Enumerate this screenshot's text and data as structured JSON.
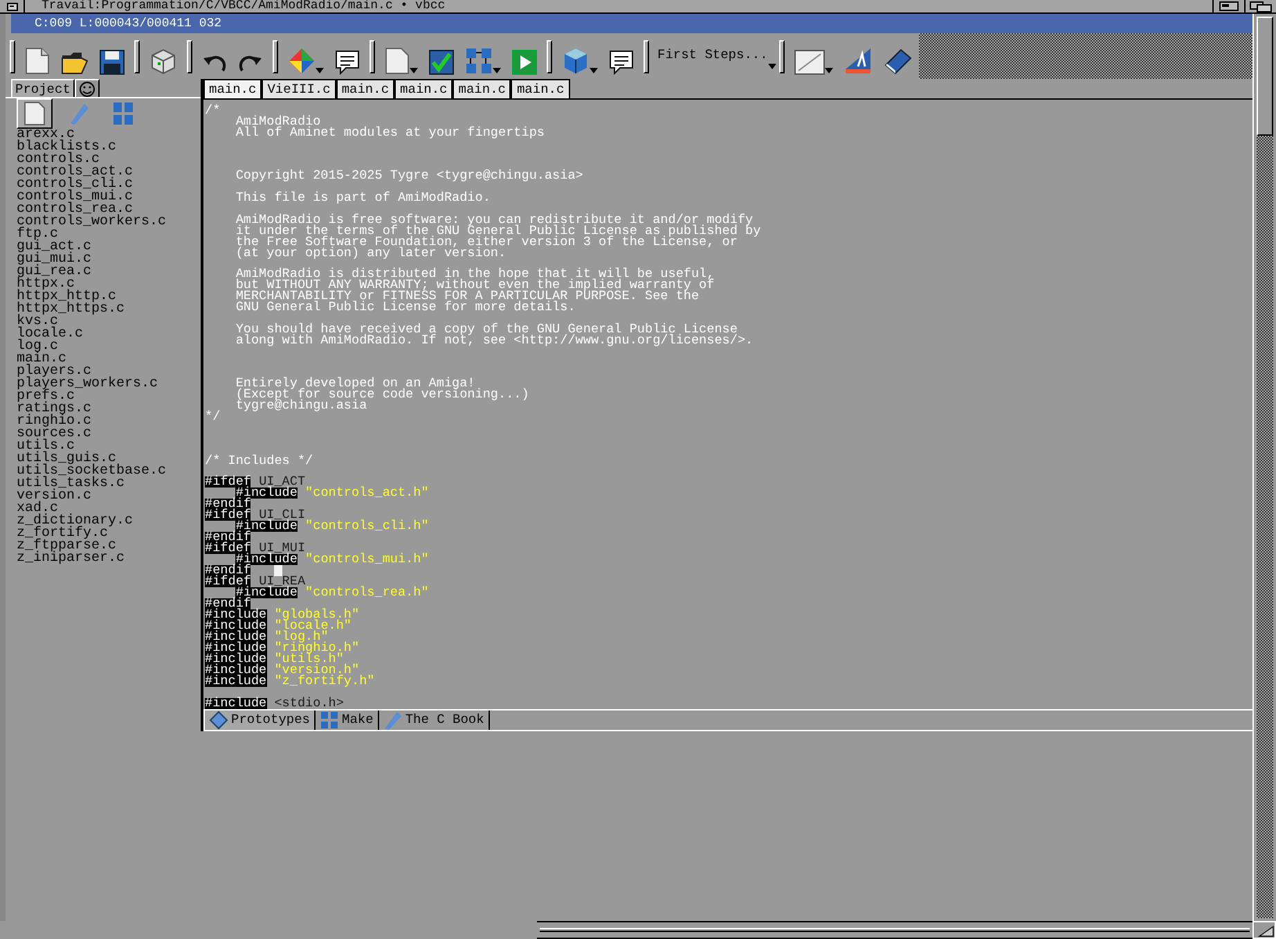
{
  "window": {
    "title": "Travail:Programmation/C/VBCC/AmiModRadio/main.c • vbcc"
  },
  "status_bar": {
    "text": "C:009 L:000043/000411 032"
  },
  "toolbar": {
    "dropdown": {
      "value": "First Steps..."
    }
  },
  "side_panel": {
    "tabs": [
      {
        "kind": "text",
        "label": "Project",
        "selected": true
      },
      {
        "kind": "smiley",
        "selected": false
      }
    ],
    "modes": [
      {
        "kind": "file",
        "selected": true
      },
      {
        "kind": "pen",
        "selected": false
      },
      {
        "kind": "grid",
        "selected": false
      }
    ],
    "files": [
      "arexx.c",
      "blacklists.c",
      "controls.c",
      "controls_act.c",
      "controls_cli.c",
      "controls_mui.c",
      "controls_rea.c",
      "controls_workers.c",
      "ftp.c",
      "gui_act.c",
      "gui_mui.c",
      "gui_rea.c",
      "httpx.c",
      "httpx_http.c",
      "httpx_https.c",
      "kvs.c",
      "locale.c",
      "log.c",
      "main.c",
      "players.c",
      "players_workers.c",
      "prefs.c",
      "ratings.c",
      "ringhio.c",
      "sources.c",
      "utils.c",
      "utils_guis.c",
      "utils_socketbase.c",
      "utils_tasks.c",
      "version.c",
      "xad.c",
      "z_dictionary.c",
      "z_fortify.c",
      "z_ftpparse.c",
      "z_iniparser.c"
    ]
  },
  "editor_tabs": [
    {
      "label": "main.c",
      "selected": true
    },
    {
      "label": "VieIII.c",
      "selected": false
    },
    {
      "label": "main.c",
      "selected": false
    },
    {
      "label": "main.c",
      "selected": false
    },
    {
      "label": "main.c",
      "selected": false
    },
    {
      "label": "main.c",
      "selected": false
    }
  ],
  "code_lines": [
    {
      "kind": "code",
      "indented": false,
      "segments": [
        {
          "kind": "comment",
          "text": "/*"
        }
      ]
    },
    {
      "kind": "code",
      "indented": true,
      "segments": [
        {
          "kind": "comment",
          "text": "AmiModRadio"
        }
      ]
    },
    {
      "kind": "code",
      "indented": true,
      "segments": [
        {
          "kind": "comment",
          "text": "All of Aminet modules at your fingertips"
        }
      ]
    },
    {
      "kind": "blank"
    },
    {
      "kind": "blank"
    },
    {
      "kind": "blank"
    },
    {
      "kind": "code",
      "indented": true,
      "segments": [
        {
          "kind": "comment",
          "text": "Copyright 2015-2025 Tygre <tygre@chingu.asia>"
        }
      ]
    },
    {
      "kind": "blank"
    },
    {
      "kind": "code",
      "indented": true,
      "segments": [
        {
          "kind": "comment",
          "text": "This file is part of AmiModRadio."
        }
      ]
    },
    {
      "kind": "blank"
    },
    {
      "kind": "code",
      "indented": true,
      "segments": [
        {
          "kind": "comment",
          "text": "AmiModRadio is free software: you can redistribute it and/or modify"
        }
      ]
    },
    {
      "kind": "code",
      "indented": true,
      "segments": [
        {
          "kind": "comment",
          "text": "it under the terms of the GNU General Public License as published by"
        }
      ]
    },
    {
      "kind": "code",
      "indented": true,
      "segments": [
        {
          "kind": "comment",
          "text": "the Free Software Foundation, either version 3 of the License, or"
        }
      ]
    },
    {
      "kind": "code",
      "indented": true,
      "segments": [
        {
          "kind": "comment",
          "text": "(at your option) any later version."
        }
      ]
    },
    {
      "kind": "blank"
    },
    {
      "kind": "code",
      "indented": true,
      "segments": [
        {
          "kind": "comment",
          "text": "AmiModRadio is distributed in the hope that it will be useful,"
        }
      ]
    },
    {
      "kind": "code",
      "indented": true,
      "segments": [
        {
          "kind": "comment",
          "text": "but WITHOUT ANY WARRANTY; without even the implied warranty of"
        }
      ]
    },
    {
      "kind": "code",
      "indented": true,
      "segments": [
        {
          "kind": "comment",
          "text": "MERCHANTABILITY or FITNESS FOR A PARTICULAR PURPOSE. See the"
        }
      ]
    },
    {
      "kind": "code",
      "indented": true,
      "segments": [
        {
          "kind": "comment",
          "text": "GNU General Public License for more details."
        }
      ]
    },
    {
      "kind": "blank"
    },
    {
      "kind": "code",
      "indented": true,
      "segments": [
        {
          "kind": "comment",
          "text": "You should have received a copy of the GNU General Public License"
        }
      ]
    },
    {
      "kind": "code",
      "indented": true,
      "segments": [
        {
          "kind": "comment",
          "text": "along with AmiModRadio. If not, see <http://www.gnu.org/licenses/>."
        }
      ]
    },
    {
      "kind": "blank"
    },
    {
      "kind": "blank"
    },
    {
      "kind": "blank"
    },
    {
      "kind": "code",
      "indented": true,
      "segments": [
        {
          "kind": "comment",
          "text": "Entirely developed on an Amiga!"
        }
      ]
    },
    {
      "kind": "code",
      "indented": true,
      "segments": [
        {
          "kind": "comment",
          "text": "(Except for source code versioning...)"
        }
      ]
    },
    {
      "kind": "code",
      "indented": true,
      "segments": [
        {
          "kind": "comment",
          "text": "tygre@chingu.asia"
        }
      ]
    },
    {
      "kind": "code",
      "indented": false,
      "segments": [
        {
          "kind": "comment",
          "text": "*/"
        }
      ]
    },
    {
      "kind": "blank"
    },
    {
      "kind": "blank"
    },
    {
      "kind": "blank"
    },
    {
      "kind": "code",
      "indented": false,
      "segments": [
        {
          "kind": "comment",
          "text": "/* Includes */"
        }
      ]
    },
    {
      "kind": "blank"
    },
    {
      "kind": "code",
      "indented": false,
      "segments": [
        {
          "kind": "directive",
          "text": "#ifdef"
        },
        {
          "kind": "plain",
          "text": "UI_ACT"
        }
      ]
    },
    {
      "kind": "code",
      "indented": true,
      "segments": [
        {
          "kind": "directive",
          "text": "#include"
        },
        {
          "kind": "string",
          "text": "\"controls_act.h\""
        }
      ]
    },
    {
      "kind": "code",
      "indented": false,
      "segments": [
        {
          "kind": "directive",
          "text": "#endif"
        }
      ]
    },
    {
      "kind": "code",
      "indented": false,
      "segments": [
        {
          "kind": "directive",
          "text": "#ifdef"
        },
        {
          "kind": "plain",
          "text": "UI_CLI"
        }
      ]
    },
    {
      "kind": "code",
      "indented": true,
      "segments": [
        {
          "kind": "directive",
          "text": "#include"
        },
        {
          "kind": "string",
          "text": "\"controls_cli.h\""
        }
      ]
    },
    {
      "kind": "code",
      "indented": false,
      "segments": [
        {
          "kind": "directive",
          "text": "#endif"
        }
      ]
    },
    {
      "kind": "code",
      "indented": false,
      "segments": [
        {
          "kind": "directive",
          "text": "#ifdef"
        },
        {
          "kind": "plain",
          "text": "UI_MUI"
        }
      ]
    },
    {
      "kind": "code",
      "indented": true,
      "segments": [
        {
          "kind": "directive",
          "text": "#include"
        },
        {
          "kind": "string",
          "text": "\"controls_mui.h\""
        }
      ]
    },
    {
      "kind": "code",
      "indented": false,
      "segments": [
        {
          "kind": "directive",
          "text": "#endif"
        },
        {
          "kind": "cursor"
        }
      ]
    },
    {
      "kind": "code",
      "indented": false,
      "segments": [
        {
          "kind": "directive",
          "text": "#ifdef"
        },
        {
          "kind": "plain",
          "text": "UI_REA"
        }
      ]
    },
    {
      "kind": "code",
      "indented": true,
      "segments": [
        {
          "kind": "directive",
          "text": "#include"
        },
        {
          "kind": "string",
          "text": "\"controls_rea.h\""
        }
      ]
    },
    {
      "kind": "code",
      "indented": false,
      "segments": [
        {
          "kind": "directive",
          "text": "#endif"
        }
      ]
    },
    {
      "kind": "code",
      "indented": false,
      "segments": [
        {
          "kind": "directive",
          "text": "#include"
        },
        {
          "kind": "string",
          "text": "\"globals.h\""
        }
      ]
    },
    {
      "kind": "code",
      "indented": false,
      "segments": [
        {
          "kind": "directive",
          "text": "#include"
        },
        {
          "kind": "string",
          "text": "\"locale.h\""
        }
      ]
    },
    {
      "kind": "code",
      "indented": false,
      "segments": [
        {
          "kind": "directive",
          "text": "#include"
        },
        {
          "kind": "string",
          "text": "\"log.h\""
        }
      ]
    },
    {
      "kind": "code",
      "indented": false,
      "segments": [
        {
          "kind": "directive",
          "text": "#include"
        },
        {
          "kind": "string",
          "text": "\"ringhio.h\""
        }
      ]
    },
    {
      "kind": "code",
      "indented": false,
      "segments": [
        {
          "kind": "directive",
          "text": "#include"
        },
        {
          "kind": "string",
          "text": "\"utils.h\""
        }
      ]
    },
    {
      "kind": "code",
      "indented": false,
      "segments": [
        {
          "kind": "directive",
          "text": "#include"
        },
        {
          "kind": "string",
          "text": "\"version.h\""
        }
      ]
    },
    {
      "kind": "code",
      "indented": false,
      "segments": [
        {
          "kind": "directive",
          "text": "#include"
        },
        {
          "kind": "string",
          "text": "\"z_fortify.h\""
        }
      ]
    },
    {
      "kind": "blank"
    },
    {
      "kind": "code",
      "indented": false,
      "segments": [
        {
          "kind": "directive",
          "text": "#include"
        },
        {
          "kind": "plain",
          "text": "<stdio.h>"
        }
      ]
    }
  ],
  "bottom_tabs": [
    {
      "kind": "diamond",
      "label": "Prototypes",
      "selected": true
    },
    {
      "kind": "grid",
      "label": "Make",
      "selected": false
    },
    {
      "kind": "pen",
      "label": "The C Book",
      "selected": false
    }
  ]
}
